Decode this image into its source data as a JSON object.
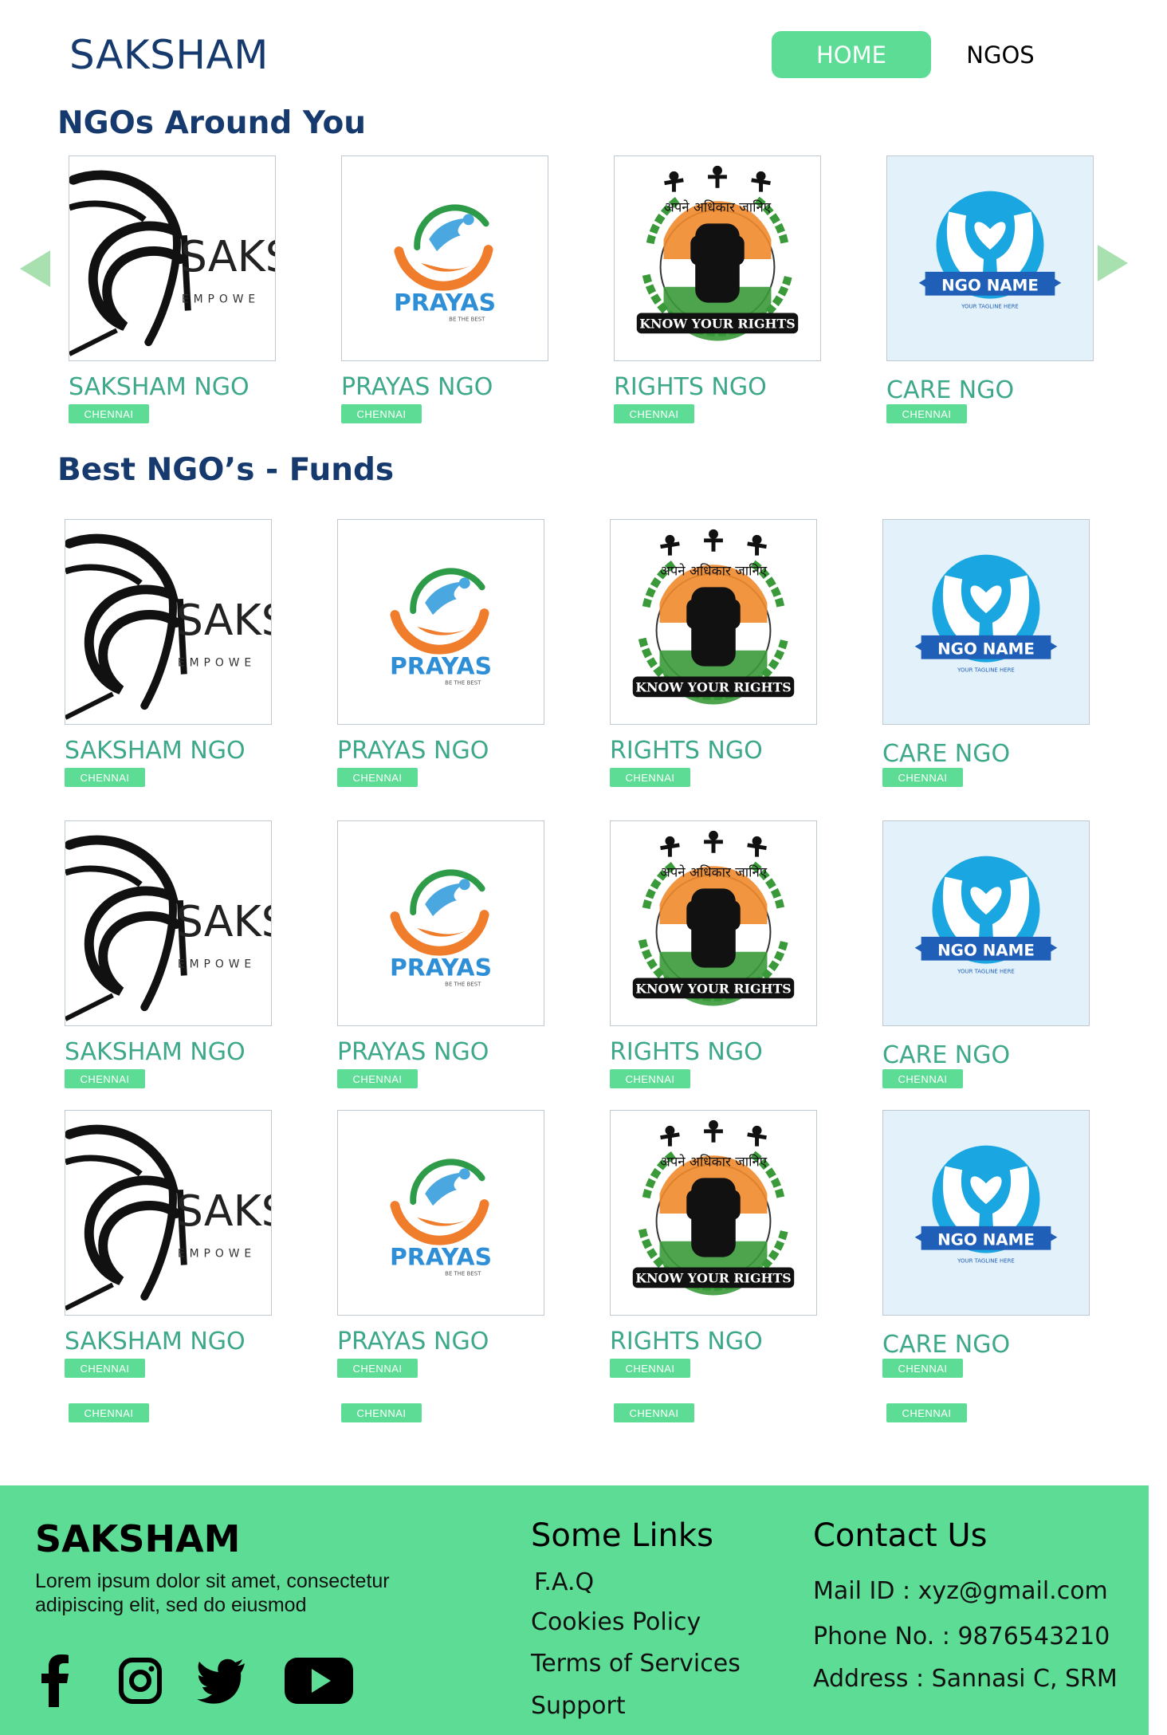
{
  "header": {
    "brand": "SAKSHAM",
    "nav": {
      "home": "HOME",
      "ngos": "NGOS"
    }
  },
  "sections": {
    "around": "NGOs Around You",
    "best": "Best NGO’s - Funds"
  },
  "ngos": [
    {
      "name": "SAKSHAM NGO",
      "location": "CHENNAI",
      "logo_text": "SAKS",
      "logo_sub": "EMPOWE"
    },
    {
      "name": "PRAYAS NGO",
      "location": "CHENNAI",
      "logo_text": "PRAYAS",
      "logo_sub": "BE THE BEST"
    },
    {
      "name": "RIGHTS NGO",
      "location": "CHENNAI",
      "logo_text": "KNOW YOUR RIGHTS",
      "logo_sub": "अपने अधिकार जानिए"
    },
    {
      "name": "CARE NGO",
      "location": "CHENNAI",
      "logo_text": "NGO NAME",
      "logo_sub": "YOUR TAGLINE HERE"
    }
  ],
  "footer": {
    "brand": "SAKSHAM",
    "description": "Lorem ipsum dolor sit amet, consectetur adipiscing elit, sed do eiusmod",
    "links_title": "Some Links",
    "links": [
      "F.A.Q",
      "Cookies Policy",
      "Terms of Services",
      "Support"
    ],
    "contact_title": "Contact Us",
    "contact": [
      "Mail ID : xyz@gmail.com",
      "Phone No. : 9876543210",
      "Address : Sannasi C, SRM"
    ],
    "social": [
      "facebook-icon",
      "instagram-icon",
      "twitter-icon",
      "youtube-icon"
    ]
  },
  "colors": {
    "accent": "#5ddc95",
    "title": "#163a6e",
    "ngo_name": "#3da88a"
  }
}
